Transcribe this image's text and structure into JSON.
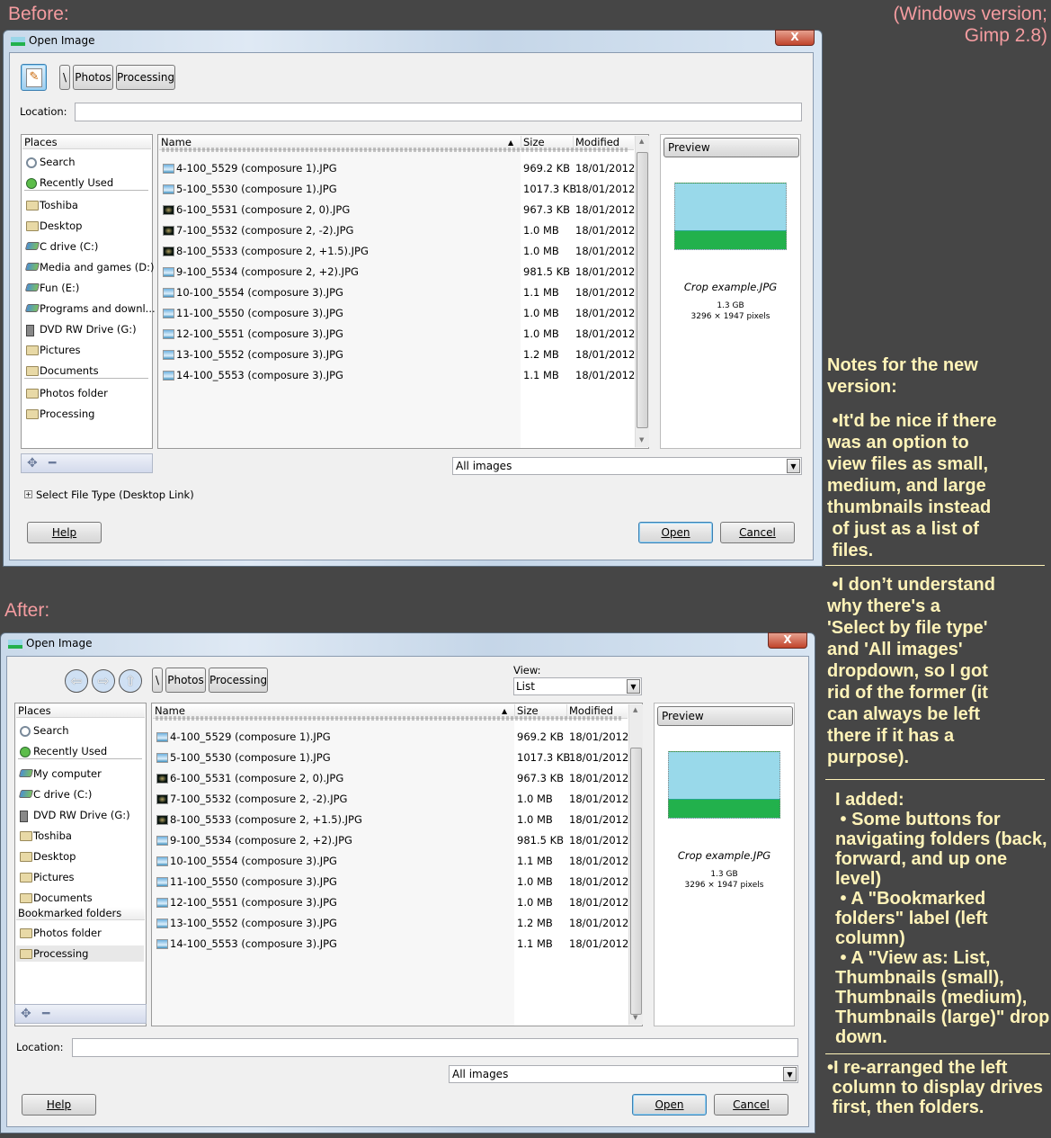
{
  "captions": {
    "before": "Before:",
    "after": "After:",
    "version_line1": "(Windows version;",
    "version_line2": "Gimp 2.8)"
  },
  "dialog_common": {
    "title": "Open Image",
    "close": "X",
    "path_buttons": [
      "\\",
      "Photos",
      "Processing"
    ],
    "location_label": "Location:",
    "location_value": "",
    "places_header": "Places",
    "columns": {
      "name": "Name",
      "size": "Size",
      "modified": "Modified"
    },
    "sort_indicator": "▲",
    "files": [
      {
        "name": "4-100_5529 (composure 1).JPG",
        "size": "969.2 KB",
        "modified": "18/01/2012",
        "icon": "image-light"
      },
      {
        "name": "5-100_5530 (composure 1).JPG",
        "size": "1017.3 KB",
        "modified": "18/01/2012",
        "icon": "image-light"
      },
      {
        "name": "6-100_5531 (composure 2, 0).JPG",
        "size": "967.3 KB",
        "modified": "18/01/2012",
        "icon": "image-dark"
      },
      {
        "name": "7-100_5532 (composure 2, -2).JPG",
        "size": "1.0 MB",
        "modified": "18/01/2012",
        "icon": "image-dark"
      },
      {
        "name": "8-100_5533 (composure 2, +1.5).JPG",
        "size": "1.0 MB",
        "modified": "18/01/2012",
        "icon": "image-dark"
      },
      {
        "name": "9-100_5534 (composure 2, +2).JPG",
        "size": "981.5 KB",
        "modified": "18/01/2012",
        "icon": "image-light"
      },
      {
        "name": "10-100_5554 (composure 3).JPG",
        "size": "1.1 MB",
        "modified": "18/01/2012",
        "icon": "image-light"
      },
      {
        "name": "11-100_5550 (composure 3).JPG",
        "size": "1.0 MB",
        "modified": "18/01/2012",
        "icon": "image-light"
      },
      {
        "name": "12-100_5551 (composure 3).JPG",
        "size": "1.0 MB",
        "modified": "18/01/2012",
        "icon": "image-light"
      },
      {
        "name": "13-100_5552 (composure 3).JPG",
        "size": "1.2 MB",
        "modified": "18/01/2012",
        "icon": "image-light"
      },
      {
        "name": "14-100_5553 (composure 3).JPG",
        "size": "1.1 MB",
        "modified": "18/01/2012",
        "icon": "image-light"
      }
    ],
    "preview": {
      "header": "Preview",
      "filename": "Crop example.JPG",
      "filesize": "1.3 GB",
      "dimensions": "3296 × 1947 pixels",
      "sky_color": "#99d9ea",
      "grass_color": "#22b14c"
    },
    "filter": "All images",
    "help": "Help",
    "open": "Open",
    "cancel": "Cancel",
    "add_icon": "add-icon",
    "remove_icon": "remove-icon"
  },
  "before": {
    "places": [
      {
        "label": "Search",
        "icon": "search"
      },
      {
        "label": "Recently Used",
        "icon": "clock"
      },
      {
        "sep": true
      },
      {
        "label": "Toshiba",
        "icon": "folder"
      },
      {
        "label": "Desktop",
        "icon": "folder"
      },
      {
        "label": "C drive (C:)",
        "icon": "drive"
      },
      {
        "label": "Media and games (D:)",
        "icon": "drive"
      },
      {
        "label": "Fun (E:)",
        "icon": "drive"
      },
      {
        "label": "Programs and downl...",
        "icon": "drive"
      },
      {
        "label": "DVD RW Drive (G:)",
        "icon": "cd"
      },
      {
        "label": "Pictures",
        "icon": "folder"
      },
      {
        "label": "Documents",
        "icon": "folder"
      },
      {
        "sep": true
      },
      {
        "label": "Photos folder",
        "icon": "folder"
      },
      {
        "label": "Processing",
        "icon": "folder"
      }
    ],
    "file_type_expander": "Select File Type (Desktop Link)"
  },
  "after": {
    "view_label": "View:",
    "view_value": "List",
    "nav_buttons": [
      {
        "name": "back",
        "glyph": "⇦"
      },
      {
        "name": "forward",
        "glyph": "⇨"
      },
      {
        "name": "up",
        "glyph": "⇧"
      }
    ],
    "places": [
      {
        "label": "Search",
        "icon": "search"
      },
      {
        "label": "Recently Used",
        "icon": "clock"
      },
      {
        "sep": true
      },
      {
        "label": "My computer",
        "icon": "drive"
      },
      {
        "label": "C drive (C:)",
        "icon": "drive"
      },
      {
        "label": "DVD RW Drive (G:)",
        "icon": "cd"
      },
      {
        "label": "Toshiba",
        "icon": "folder"
      },
      {
        "label": "Desktop",
        "icon": "folder"
      },
      {
        "label": "Pictures",
        "icon": "folder"
      },
      {
        "label": "Documents",
        "icon": "folder"
      },
      {
        "header": "Bookmarked folders"
      },
      {
        "label": "Photos folder",
        "icon": "folder"
      },
      {
        "label": "Processing",
        "icon": "folder",
        "selected": true
      }
    ]
  },
  "notes": {
    "title": "Notes for the new\nversion:",
    "note1": " •It'd be nice if there\nwas an option to\nview files as small,\nmedium, and large\nthumbnails instead\n of just as a list of\n files.",
    "note2": " •I don’t understand\nwhy there's a\n'Select by file type'\nand 'All images'\ndropdown, so I got\nrid of the former (it\ncan always be left\nthere if it has a\npurpose).",
    "note3": "I added:\n • Some buttons for\nnavigating folders (back,\nforward, and up one\nlevel)\n • A \"Bookmarked\nfolders\" label (left\ncolumn)\n • A \"View as: List,\nThumbnails (small),\nThumbnails (medium),\nThumbnails (large)\" drop\ndown.",
    "note4": "•I re-arranged the left\n column to display drives\n first, then folders."
  },
  "colors": {
    "background": "#464646",
    "caption": "#f49ca0",
    "notes_text": "#fff3b8"
  }
}
